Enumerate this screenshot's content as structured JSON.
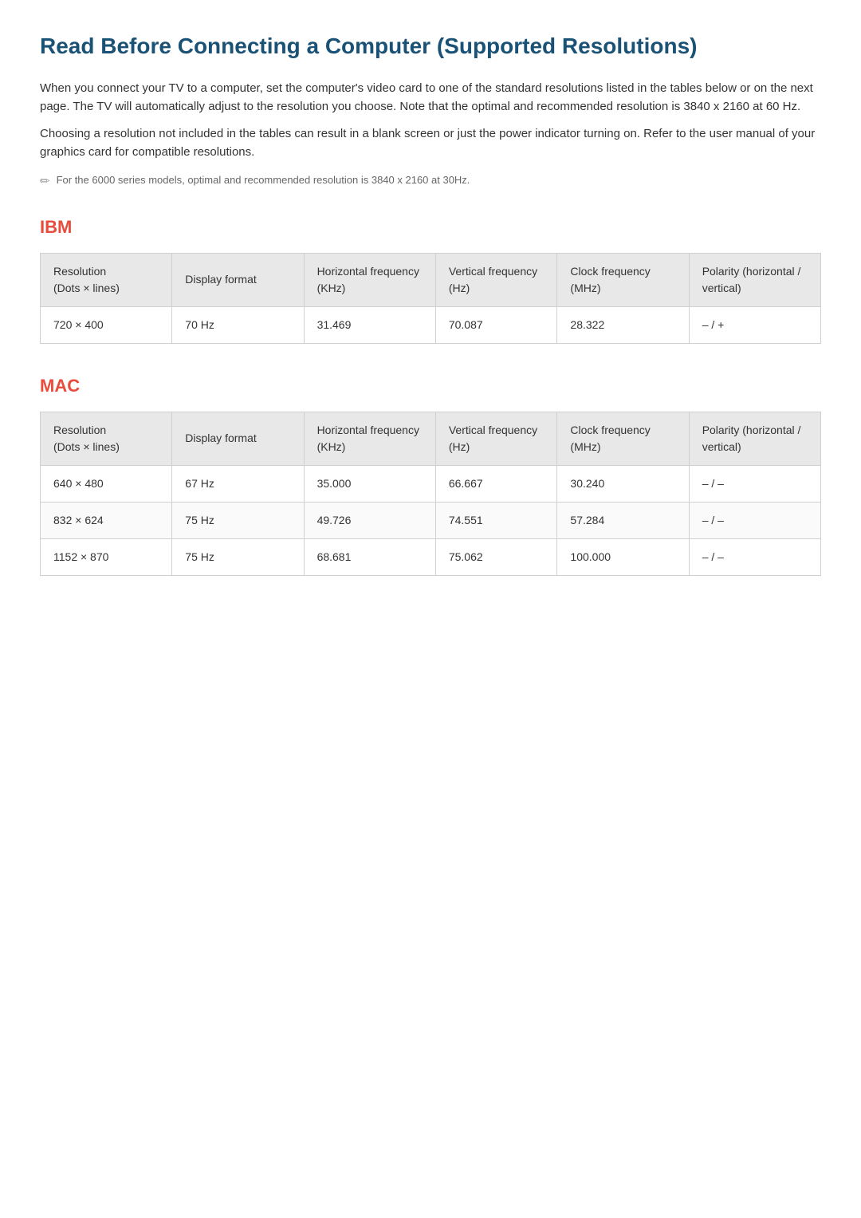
{
  "page": {
    "title": "Read Before Connecting a Computer (Supported Resolutions)",
    "intro1": "When you connect your TV to a computer, set the computer's video card to one of the standard resolutions listed in the tables below or on the next page. The TV will automatically adjust to the resolution you choose. Note that the optimal and recommended resolution is 3840 x 2160 at 60 Hz.",
    "intro2": "Choosing a resolution not included in the tables can result in a blank screen or just the power indicator turning on. Refer to the user manual of your graphics card for compatible resolutions.",
    "note": "For the 6000 series models, optimal and recommended resolution is 3840 x 2160 at 30Hz."
  },
  "ibm_section": {
    "title": "IBM",
    "columns": {
      "resolution": "Resolution\n(Dots × lines)",
      "display_format": "Display format",
      "horizontal": "Horizontal frequency (KHz)",
      "vertical": "Vertical frequency (Hz)",
      "clock": "Clock frequency (MHz)",
      "polarity": "Polarity (horizontal / vertical)"
    },
    "rows": [
      {
        "resolution": "720 × 400",
        "display_format": "70 Hz",
        "horizontal": "31.469",
        "vertical": "70.087",
        "clock": "28.322",
        "polarity": "– / +"
      }
    ]
  },
  "mac_section": {
    "title": "MAC",
    "columns": {
      "resolution": "Resolution\n(Dots × lines)",
      "display_format": "Display format",
      "horizontal": "Horizontal frequency (KHz)",
      "vertical": "Vertical frequency (Hz)",
      "clock": "Clock frequency (MHz)",
      "polarity": "Polarity (horizontal / vertical)"
    },
    "rows": [
      {
        "resolution": "640 × 480",
        "display_format": "67 Hz",
        "horizontal": "35.000",
        "vertical": "66.667",
        "clock": "30.240",
        "polarity": "– / –"
      },
      {
        "resolution": "832 × 624",
        "display_format": "75 Hz",
        "horizontal": "49.726",
        "vertical": "74.551",
        "clock": "57.284",
        "polarity": "– / –"
      },
      {
        "resolution": "1152 × 870",
        "display_format": "75 Hz",
        "horizontal": "68.681",
        "vertical": "75.062",
        "clock": "100.000",
        "polarity": "– / –"
      }
    ]
  }
}
